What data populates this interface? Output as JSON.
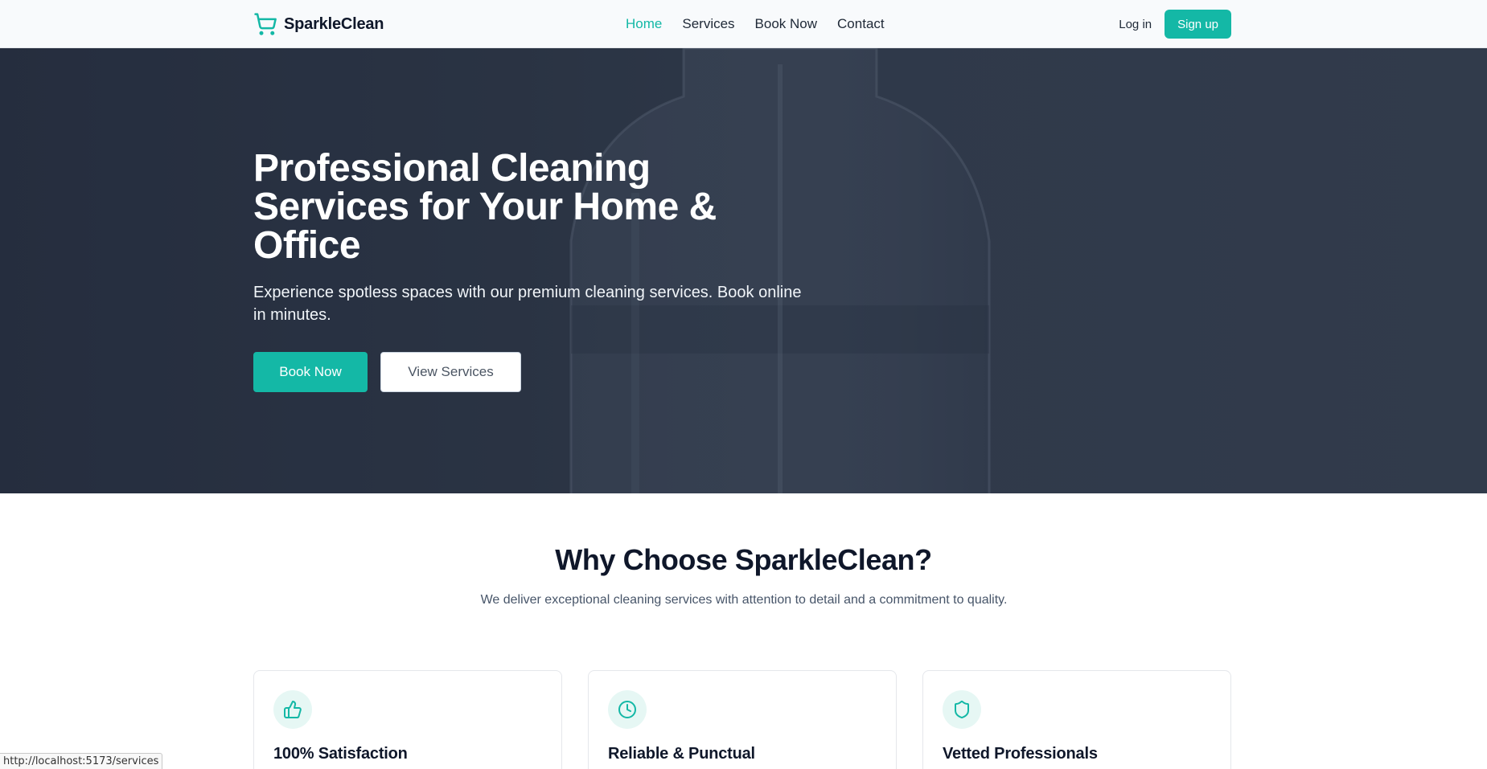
{
  "brand": {
    "name": "SparkleClean",
    "icon": "shopping-cart-icon",
    "accent_color": "#14b8a6"
  },
  "nav": {
    "links": [
      {
        "label": "Home",
        "active": true
      },
      {
        "label": "Services",
        "active": false
      },
      {
        "label": "Book Now",
        "active": false
      },
      {
        "label": "Contact",
        "active": false
      }
    ],
    "login_label": "Log in",
    "signup_label": "Sign up"
  },
  "hero": {
    "title": "Professional Cleaning Services for Your Home & Office",
    "subtitle": "Experience spotless spaces with our premium cleaning services. Book online in minutes.",
    "primary_button": "Book Now",
    "secondary_button": "View Services"
  },
  "why": {
    "title": "Why Choose SparkleClean?",
    "subtitle": "We deliver exceptional cleaning services with attention to detail and a commitment to quality.",
    "cards": [
      {
        "title": "100% Satisfaction",
        "icon": "thumbs-up-icon"
      },
      {
        "title": "Reliable & Punctual",
        "icon": "clock-icon"
      },
      {
        "title": "Vetted Professionals",
        "icon": "shield-icon"
      }
    ]
  },
  "status_bar": {
    "url": "http://localhost:5173/services"
  }
}
